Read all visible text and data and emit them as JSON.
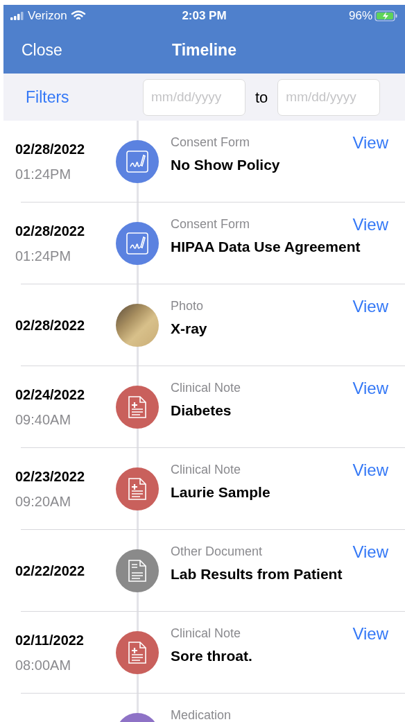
{
  "status_bar": {
    "carrier": "Verizon",
    "time": "2:03 PM",
    "battery": "96%"
  },
  "nav": {
    "left": "Close",
    "title": "Timeline"
  },
  "filters": {
    "label": "Filters",
    "from_placeholder": "mm/dd/yyyy",
    "separator": "to",
    "to_placeholder": "mm/dd/yyyy"
  },
  "items": [
    {
      "date": "02/28/2022",
      "time": "01:24PM",
      "kind": "signature",
      "category": "Consent Form",
      "title": "No Show Policy",
      "action": "View"
    },
    {
      "date": "02/28/2022",
      "time": "01:24PM",
      "kind": "signature",
      "category": "Consent Form",
      "title": "HIPAA Data Use Agreement",
      "action": "View"
    },
    {
      "date": "02/28/2022",
      "kind": "photo",
      "category": "Photo",
      "title": "X-ray",
      "action": "View"
    },
    {
      "date": "02/24/2022",
      "time": "09:40AM",
      "kind": "clinical",
      "category": "Clinical Note",
      "title": "Diabetes",
      "action": "View"
    },
    {
      "date": "02/23/2022",
      "time": "09:20AM",
      "kind": "clinical",
      "category": "Clinical Note",
      "title": "Laurie Sample",
      "action": "View"
    },
    {
      "date": "02/22/2022",
      "kind": "document",
      "category": "Other Document",
      "title": "Lab Results from Patient",
      "action": "View"
    },
    {
      "date": "02/11/2022",
      "time": "08:00AM",
      "kind": "clinical",
      "category": "Clinical Note",
      "title": "Sore throat.",
      "action": "View"
    },
    {
      "kind": "medication",
      "category": "Medication"
    }
  ]
}
